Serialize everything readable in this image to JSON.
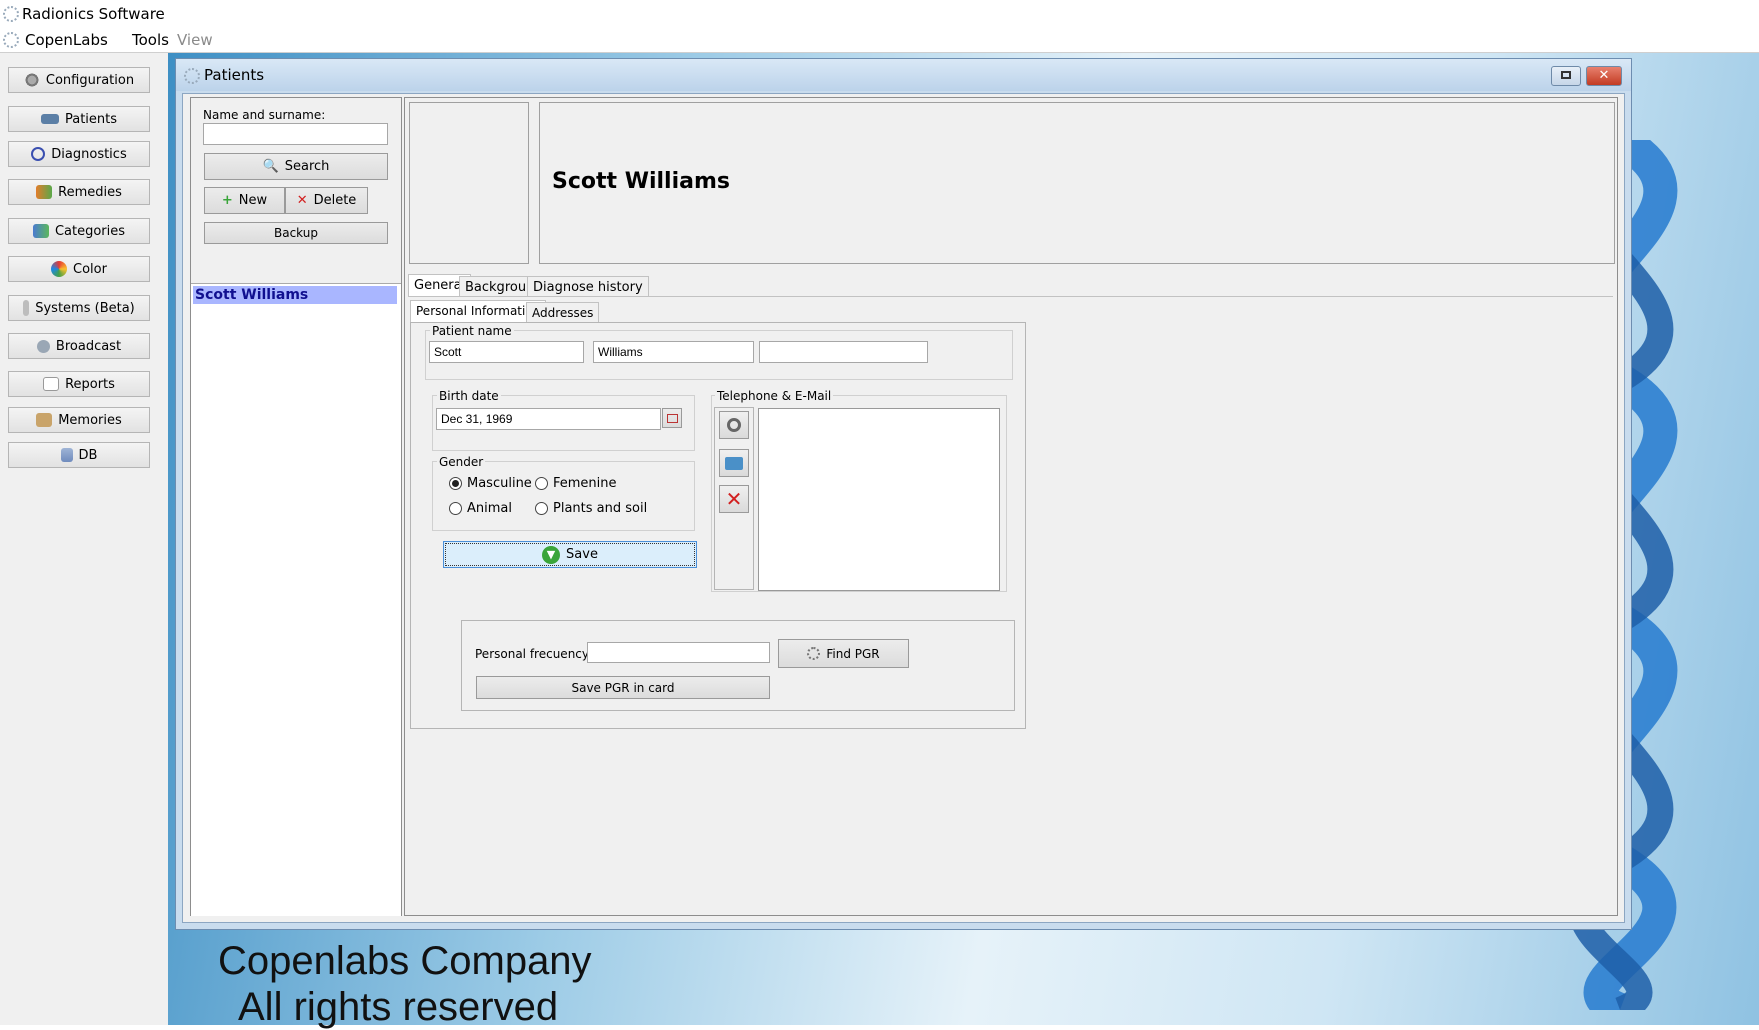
{
  "app": {
    "title": "Radionics Software"
  },
  "menu": {
    "items": [
      "CopenLabs",
      "Tools",
      "View"
    ]
  },
  "sidebar": {
    "items": [
      {
        "label": "Configuration",
        "icon": "gear-icon"
      },
      {
        "label": "Patients",
        "icon": "patients-icon"
      },
      {
        "label": "Diagnostics",
        "icon": "target-icon"
      },
      {
        "label": "Remedies",
        "icon": "remedies-icon"
      },
      {
        "label": "Categories",
        "icon": "categories-icon"
      },
      {
        "label": "Color",
        "icon": "color-wheel-icon"
      },
      {
        "label": "Systems (Beta)",
        "icon": "body-icon"
      },
      {
        "label": "Broadcast",
        "icon": "broadcast-icon"
      },
      {
        "label": "Reports",
        "icon": "reports-icon"
      },
      {
        "label": "Memories",
        "icon": "clipboard-icon"
      },
      {
        "label": "DB",
        "icon": "database-icon"
      }
    ]
  },
  "window": {
    "title": "Patients"
  },
  "search_panel": {
    "name_label": "Name and surname:",
    "name_value": "",
    "search_label": "Search",
    "new_label": "New",
    "delete_label": "Delete",
    "backup_label": "Backup"
  },
  "patient_list": {
    "items": [
      "Scott Williams"
    ],
    "selected": "Scott Williams"
  },
  "header": {
    "patient_name": "Scott Williams"
  },
  "tabs": {
    "main": [
      "General",
      "Background",
      "Diagnose history"
    ],
    "sub": [
      "Personal Information",
      "Addresses"
    ]
  },
  "form": {
    "patient_name_label": "Patient name",
    "first_name": "Scott",
    "last_name": "Williams",
    "extra_name": "",
    "birth_date_label": "Birth date",
    "birth_date": "Dec 31, 1969",
    "gender_label": "Gender",
    "gender_options": [
      "Masculine",
      "Femenine",
      "Animal",
      "Plants and soil"
    ],
    "gender_selected": "Masculine",
    "save_label": "Save",
    "contact_label": "Telephone & E-Mail",
    "personal_frequency_label": "Personal frecuency",
    "personal_frequency_value": "",
    "find_pgr_label": "Find PGR",
    "save_pgr_label": "Save PGR in card"
  },
  "footer": {
    "line1": "Copenlabs Company",
    "line2": "All rights reserved"
  },
  "colors": {
    "selected_row": "#a9b6ff",
    "save_button": "#dbeefb",
    "accent_green": "#3aa53a",
    "delete_red": "#d22020"
  }
}
